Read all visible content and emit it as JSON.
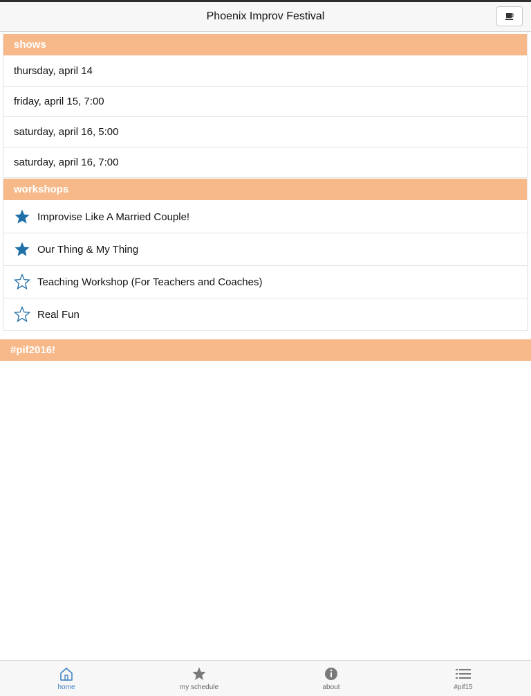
{
  "header": {
    "title": "Phoenix Improv Festival",
    "button_icon": "coffee-cup-icon"
  },
  "sections": {
    "shows": {
      "label": "shows",
      "items": [
        {
          "label": "thursday, april 14"
        },
        {
          "label": "friday, april 15, 7:00"
        },
        {
          "label": "saturday, april 16, 5:00"
        },
        {
          "label": "saturday, april 16, 7:00"
        }
      ]
    },
    "workshops": {
      "label": "workshops",
      "items": [
        {
          "label": "Improvise Like A Married Couple!",
          "starred": true
        },
        {
          "label": "Our Thing & My Thing",
          "starred": true
        },
        {
          "label": "Teaching Workshop (For Teachers and Coaches)",
          "starred": false
        },
        {
          "label": "Real Fun",
          "starred": false
        }
      ]
    },
    "hashtag": {
      "label": "#pif2016!"
    }
  },
  "tabbar": {
    "tabs": [
      {
        "label": "home",
        "icon": "home-icon",
        "active": true
      },
      {
        "label": "my schedule",
        "icon": "star-icon",
        "active": false
      },
      {
        "label": "about",
        "icon": "info-icon",
        "active": false
      },
      {
        "label": "#pif15",
        "icon": "list-icon",
        "active": false
      }
    ]
  },
  "colors": {
    "section_bar": "#f7b98a",
    "star_blue": "#1f6fa8",
    "tab_active": "#3c7fc1",
    "tab_inactive": "#666666"
  }
}
